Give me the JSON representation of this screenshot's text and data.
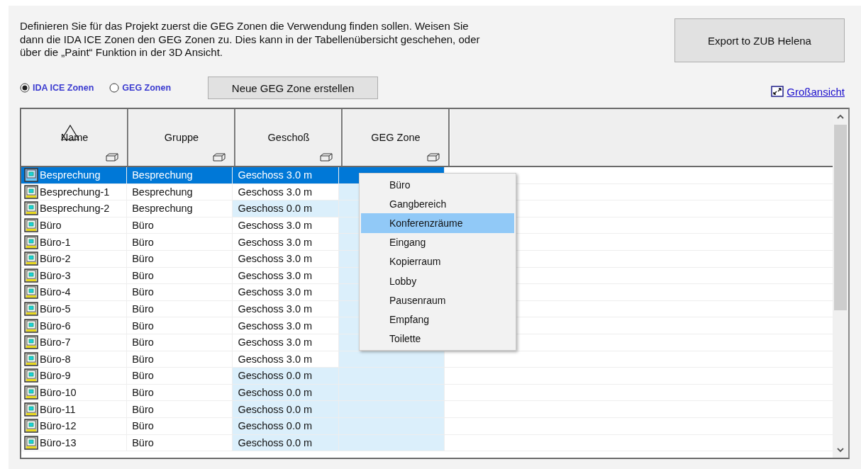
{
  "intro": "Definieren Sie für das Projekt zuerst die GEG Zonen die Verwendung finden sollen. Weisen Sie dann die IDA ICE Zonen den GEG Zonen zu. Dies kann in der Tabellenübersicht geschehen, oder über die „Paint“ Funktion in der 3D Ansicht.",
  "export_button": "Export to ZUB Helena",
  "view_options": [
    {
      "label": "IDA ICE Zonen",
      "selected": true
    },
    {
      "label": "GEG Zonen",
      "selected": false
    }
  ],
  "create_button": "Neue GEG Zone erstellen",
  "enlarge_link": "Großansicht",
  "table": {
    "columns": [
      "Name",
      "Gruppe",
      "Geschoß",
      "GEG Zone"
    ],
    "rows": [
      {
        "name": "Besprechung",
        "group": "Besprechung",
        "floor": "Geschoss 3.0 m",
        "floor_highlighted": false,
        "selected": true
      },
      {
        "name": "Besprechung-1",
        "group": "Besprechung",
        "floor": "Geschoss 3.0 m",
        "floor_highlighted": false,
        "selected": false
      },
      {
        "name": "Besprechung-2",
        "group": "Besprechung",
        "floor": "Geschoss 0.0 m",
        "floor_highlighted": true,
        "selected": false
      },
      {
        "name": "Büro",
        "group": "Büro",
        "floor": "Geschoss 3.0 m",
        "floor_highlighted": false,
        "selected": false
      },
      {
        "name": "Büro-1",
        "group": "Büro",
        "floor": "Geschoss 3.0 m",
        "floor_highlighted": false,
        "selected": false
      },
      {
        "name": "Büro-2",
        "group": "Büro",
        "floor": "Geschoss 3.0 m",
        "floor_highlighted": false,
        "selected": false
      },
      {
        "name": "Büro-3",
        "group": "Büro",
        "floor": "Geschoss 3.0 m",
        "floor_highlighted": false,
        "selected": false
      },
      {
        "name": "Büro-4",
        "group": "Büro",
        "floor": "Geschoss 3.0 m",
        "floor_highlighted": false,
        "selected": false
      },
      {
        "name": "Büro-5",
        "group": "Büro",
        "floor": "Geschoss 3.0 m",
        "floor_highlighted": false,
        "selected": false
      },
      {
        "name": "Büro-6",
        "group": "Büro",
        "floor": "Geschoss 3.0 m",
        "floor_highlighted": false,
        "selected": false
      },
      {
        "name": "Büro-7",
        "group": "Büro",
        "floor": "Geschoss 3.0 m",
        "floor_highlighted": false,
        "selected": false
      },
      {
        "name": "Büro-8",
        "group": "Büro",
        "floor": "Geschoss 3.0 m",
        "floor_highlighted": false,
        "selected": false
      },
      {
        "name": "Büro-9",
        "group": "Büro",
        "floor": "Geschoss 0.0 m",
        "floor_highlighted": true,
        "selected": false
      },
      {
        "name": "Büro-10",
        "group": "Büro",
        "floor": "Geschoss 0.0 m",
        "floor_highlighted": true,
        "selected": false
      },
      {
        "name": "Büro-11",
        "group": "Büro",
        "floor": "Geschoss 0.0 m",
        "floor_highlighted": true,
        "selected": false
      },
      {
        "name": "Büro-12",
        "group": "Büro",
        "floor": "Geschoss 0.0 m",
        "floor_highlighted": true,
        "selected": false
      },
      {
        "name": "Büro-13",
        "group": "Büro",
        "floor": "Geschoss 0.0 m",
        "floor_highlighted": true,
        "selected": false
      }
    ]
  },
  "dropdown_menu": [
    {
      "label": "Büro",
      "selected": false
    },
    {
      "label": "Gangbereich",
      "selected": false
    },
    {
      "label": "Konferenzräume",
      "selected": true
    },
    {
      "label": "Eingang",
      "selected": false
    },
    {
      "label": "Kopierraum",
      "selected": false
    },
    {
      "label": "Lobby",
      "selected": false
    },
    {
      "label": "Pausenraum",
      "selected": false
    },
    {
      "label": "Empfang",
      "selected": false
    },
    {
      "label": "Toilette",
      "selected": false
    }
  ]
}
